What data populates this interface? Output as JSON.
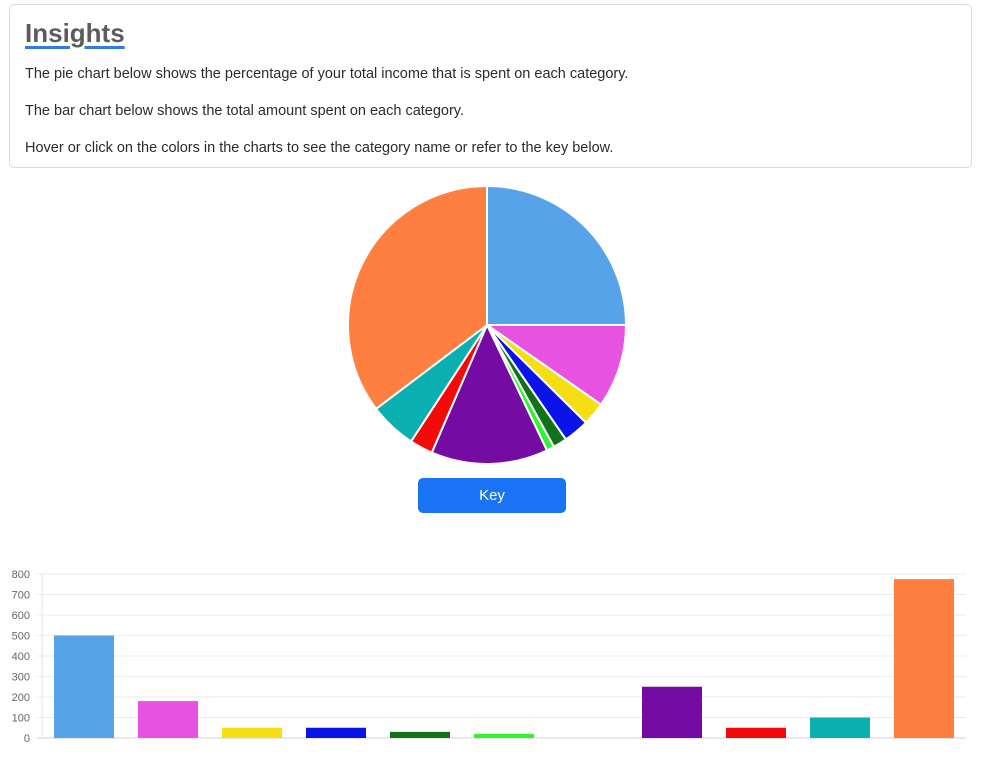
{
  "insights": {
    "title": "Insights",
    "lines": [
      "The pie chart below shows the percentage of your total income that is spent on each category.",
      "The bar chart below shows the total amount spent on each category.",
      "Hover or click on the colors in the charts to see the category name or refer to the key below."
    ]
  },
  "key_button": {
    "label": "Key"
  },
  "chart_data": [
    {
      "type": "pie",
      "colors": [
        "#57a3ea",
        "#e852e0",
        "#f5de12",
        "#0a14e8",
        "#12711a",
        "#33f233",
        "#740ba3",
        "#f50a0a",
        "#0aafaf",
        "#ff7f40"
      ],
      "values": [
        25.0,
        9.7,
        2.7,
        3.0,
        1.6,
        0.9,
        13.6,
        2.7,
        5.5,
        35.3
      ]
    },
    {
      "type": "bar",
      "colors": [
        "#57a3ea",
        "#e852e0",
        "#f5de12",
        "#0a14e8",
        "#12711a",
        "#33f233",
        "#cccccc",
        "#740ba3",
        "#f50a0a",
        "#0aafaf",
        "#ff7f40"
      ],
      "values": [
        500,
        180,
        50,
        50,
        30,
        20,
        0,
        250,
        50,
        100,
        775
      ],
      "ylim": [
        0,
        800
      ],
      "yticks": [
        "0",
        "100",
        "200",
        "300",
        "400",
        "500",
        "600",
        "700",
        "800"
      ],
      "grid": true
    }
  ]
}
